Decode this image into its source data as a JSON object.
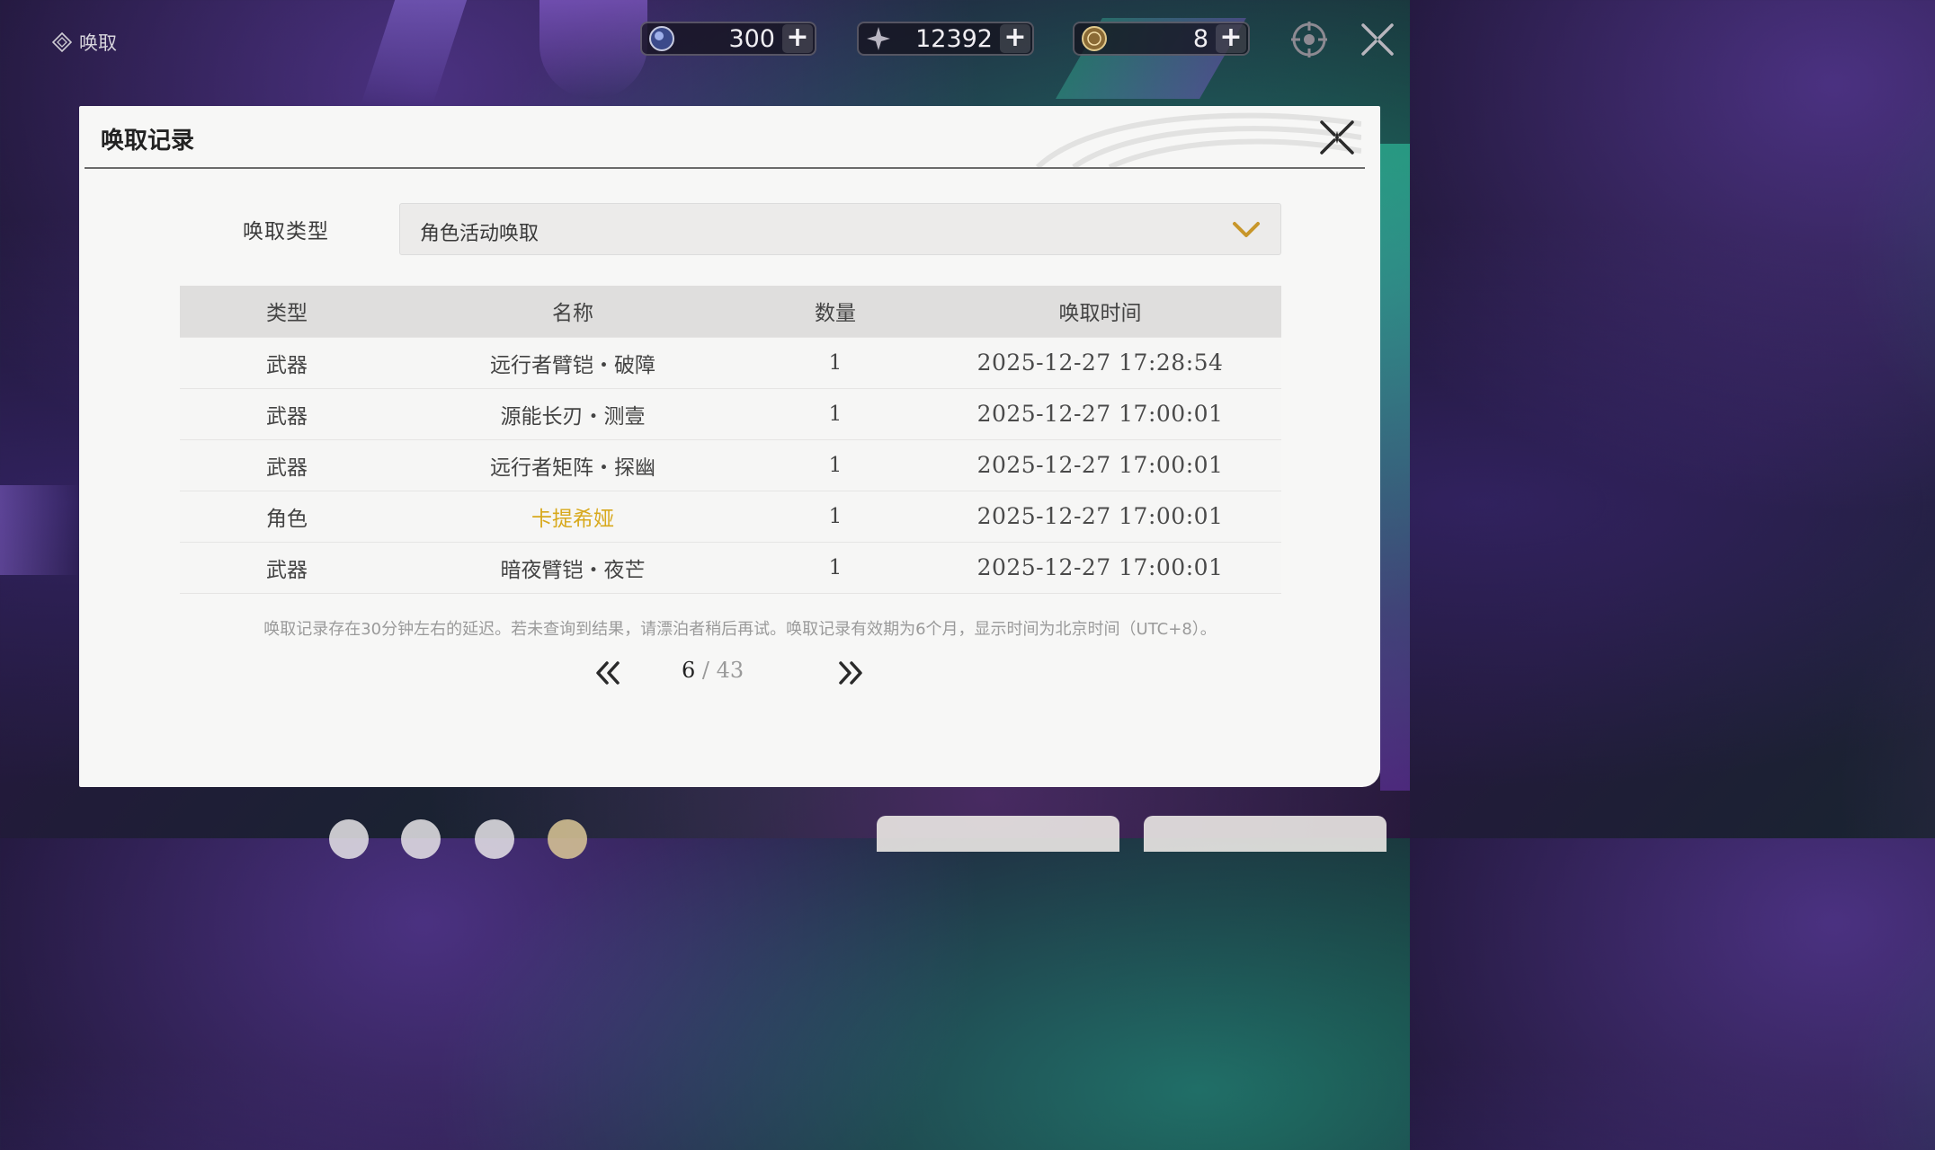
{
  "topbar": {
    "title": "唤取",
    "currencies": [
      {
        "icon": "lunite-orb-icon",
        "value": "300",
        "plus": "+"
      },
      {
        "icon": "astrite-star-icon",
        "value": "12392",
        "plus": "+"
      },
      {
        "icon": "radiant-tide-coin-icon",
        "value": "8",
        "plus": "+"
      }
    ]
  },
  "modal": {
    "title": "唤取记录",
    "filter": {
      "label": "唤取类型",
      "value": "角色活动唤取"
    },
    "table": {
      "headers": [
        "类型",
        "名称",
        "数量",
        "唤取时间"
      ],
      "rows": [
        {
          "type": "武器",
          "name": "远行者臂铠・破障",
          "qty": "1",
          "time": "2025-12-27 17:28:54"
        },
        {
          "type": "武器",
          "name": "源能长刃・测壹",
          "qty": "1",
          "time": "2025-12-27 17:00:01"
        },
        {
          "type": "武器",
          "name": "远行者矩阵・探幽",
          "qty": "1",
          "time": "2025-12-27 17:00:01"
        },
        {
          "type": "角色",
          "name": "卡提希娅",
          "qty": "1",
          "time": "2025-12-27 17:00:01"
        },
        {
          "type": "武器",
          "name": "暗夜臂铠・夜芒",
          "qty": "1",
          "time": "2025-12-27 17:00:01"
        }
      ]
    },
    "notice": "唤取记录存在30分钟左右的延迟。若未查询到结果，请漂泊者稍后再试。唤取记录有效期为6个月，显示时间为北京时间（UTC+8）。",
    "pager": {
      "current": "6",
      "separator": " / ",
      "total": "43"
    }
  },
  "colors": {
    "highlight_name": "#d8a91d",
    "chevron": "#c8962a"
  }
}
